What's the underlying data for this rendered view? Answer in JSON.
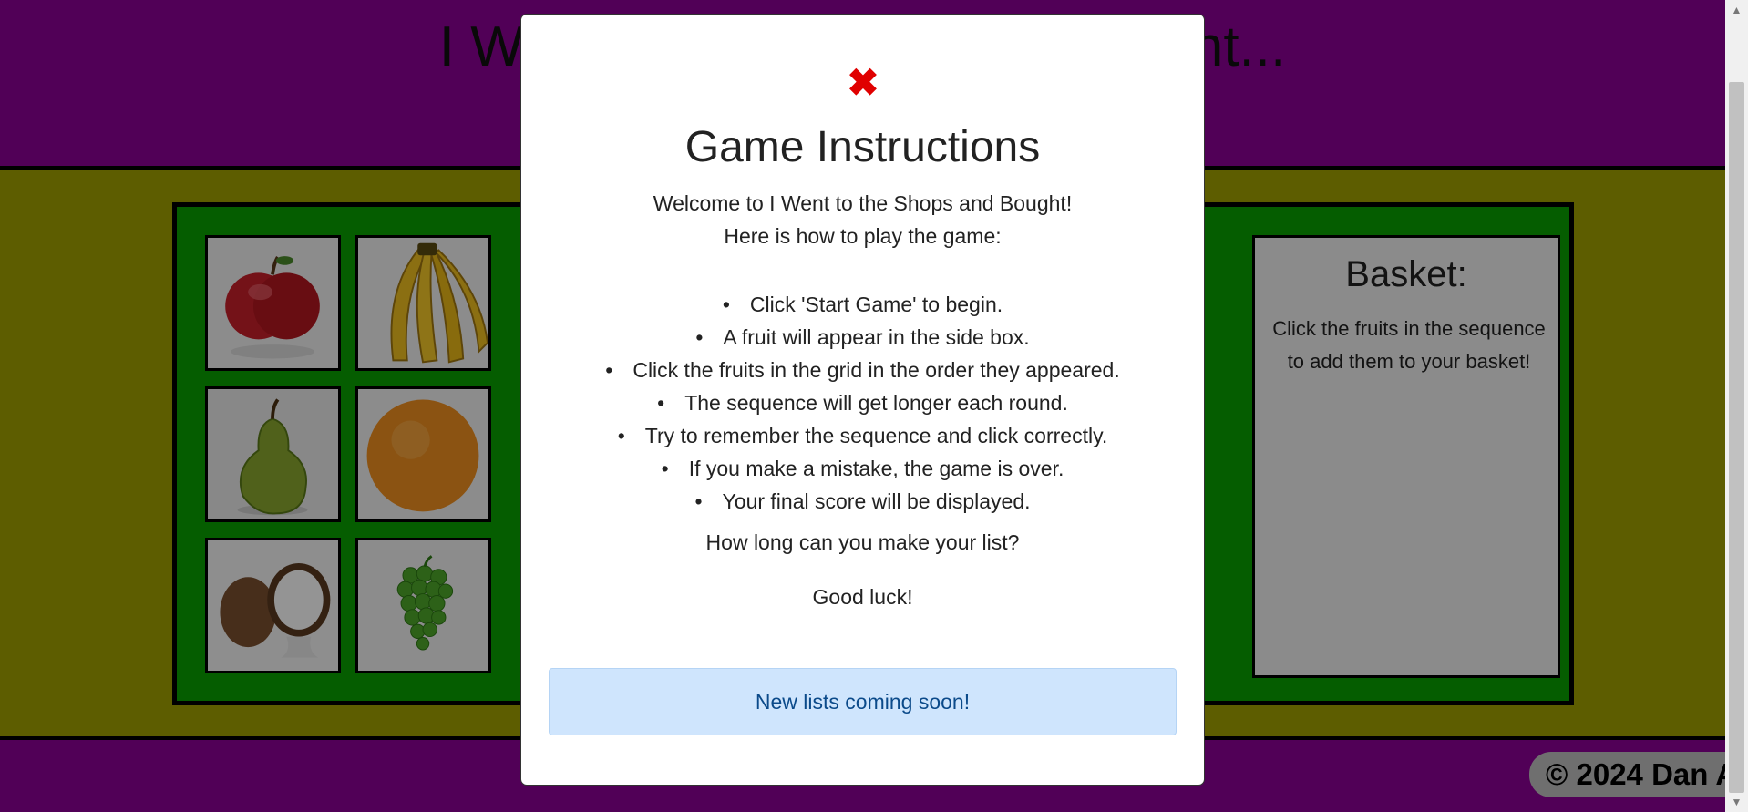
{
  "header": {
    "title": "I Went to the Shops and Bought..."
  },
  "basket": {
    "title": "Basket:",
    "text": "Click the fruits in the sequence to add them to your basket!"
  },
  "fruits": [
    {
      "name": "apple"
    },
    {
      "name": "banana"
    },
    {
      "name": "pear"
    },
    {
      "name": "orange"
    },
    {
      "name": "coconut"
    },
    {
      "name": "grapes"
    }
  ],
  "footer": {
    "copyright": "© 2024 Dan A"
  },
  "modal": {
    "close_icon": "✖",
    "title": "Game Instructions",
    "intro_line1": "Welcome to I Went to the Shops and Bought!",
    "intro_line2": "Here is how to play the game:",
    "steps": [
      "Click 'Start Game' to begin.",
      "A fruit will appear in the side box.",
      "Click the fruits in the grid in the order they appeared.",
      "The sequence will get longer each round.",
      "Try to remember the sequence and click correctly.",
      "If you make a mistake, the game is over.",
      "Your final score will be displayed."
    ],
    "question": "How long can you make your list?",
    "good_luck": "Good luck!",
    "notice": "New lists coming soon!"
  },
  "colors": {
    "header_bg": "#8c0096",
    "main_bg": "#a0a000",
    "board_bg": "#0aa000",
    "close_red": "#e00000",
    "notice_bg": "#cfe5fd"
  }
}
